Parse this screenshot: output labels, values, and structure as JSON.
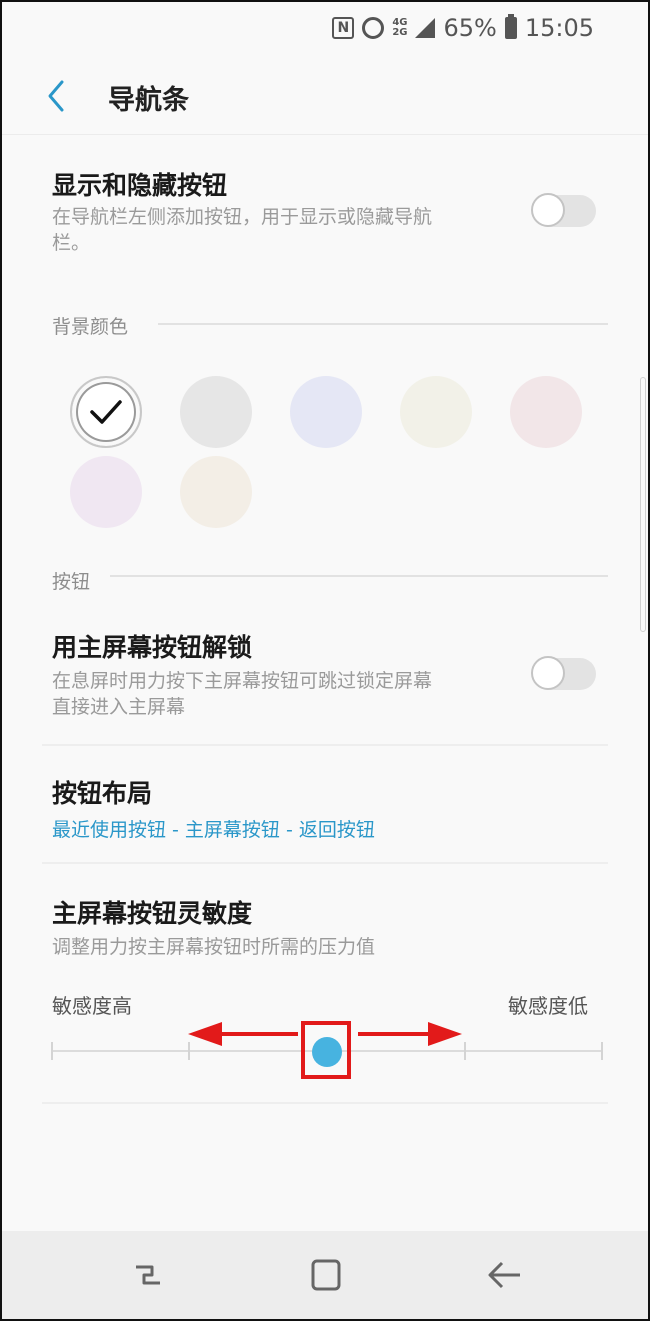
{
  "status_bar": {
    "nfc_label": "N",
    "net_top": "4G",
    "net_bottom": "2G",
    "battery": "65%",
    "time": "15:05"
  },
  "header": {
    "title": "导航条",
    "back_icon": "chevron-left-icon"
  },
  "show_hide": {
    "title": "显示和隐藏按钮",
    "subtitle_line1": "在导航栏左侧添加按钮，用于显示或隐藏导航",
    "subtitle_line2": "栏。",
    "toggle_on": false
  },
  "background_color": {
    "section_label": "背景颜色",
    "swatches": [
      {
        "name": "white",
        "color": "#ffffff",
        "selected": true
      },
      {
        "name": "light-gray",
        "color": "#e6e6e6",
        "selected": false
      },
      {
        "name": "light-blue",
        "color": "#e5e7f5",
        "selected": false
      },
      {
        "name": "light-cream",
        "color": "#f2f1e8",
        "selected": false
      },
      {
        "name": "light-pink",
        "color": "#f2e6e8",
        "selected": false
      },
      {
        "name": "light-lavender",
        "color": "#f0e7f2",
        "selected": false
      },
      {
        "name": "light-beige",
        "color": "#f3eee6",
        "selected": false
      }
    ],
    "check_icon": "check-icon"
  },
  "buttons_section": {
    "section_label": "按钮"
  },
  "unlock_home": {
    "title": "用主屏幕按钮解锁",
    "subtitle_line1": "在息屏时用力按下主屏幕按钮可跳过锁定屏幕",
    "subtitle_line2": "直接进入主屏幕",
    "toggle_on": false
  },
  "button_layout": {
    "title": "按钮布局",
    "value": "最近使用按钮 - 主屏幕按钮 - 返回按钮"
  },
  "home_sensitivity": {
    "title": "主屏幕按钮灵敏度",
    "subtitle": "调整用力按主屏幕按钮时所需的压力值",
    "label_high": "敏感度高",
    "label_low": "敏感度低",
    "level_fraction": 0.5
  },
  "nav_bar": {
    "recents_icon": "recents-icon",
    "home_icon": "home-icon",
    "back_icon": "back-arrow-icon"
  },
  "colors": {
    "accent": "#2a97c9",
    "thumb": "#47b3e0",
    "annotation": "#e21a1a"
  }
}
